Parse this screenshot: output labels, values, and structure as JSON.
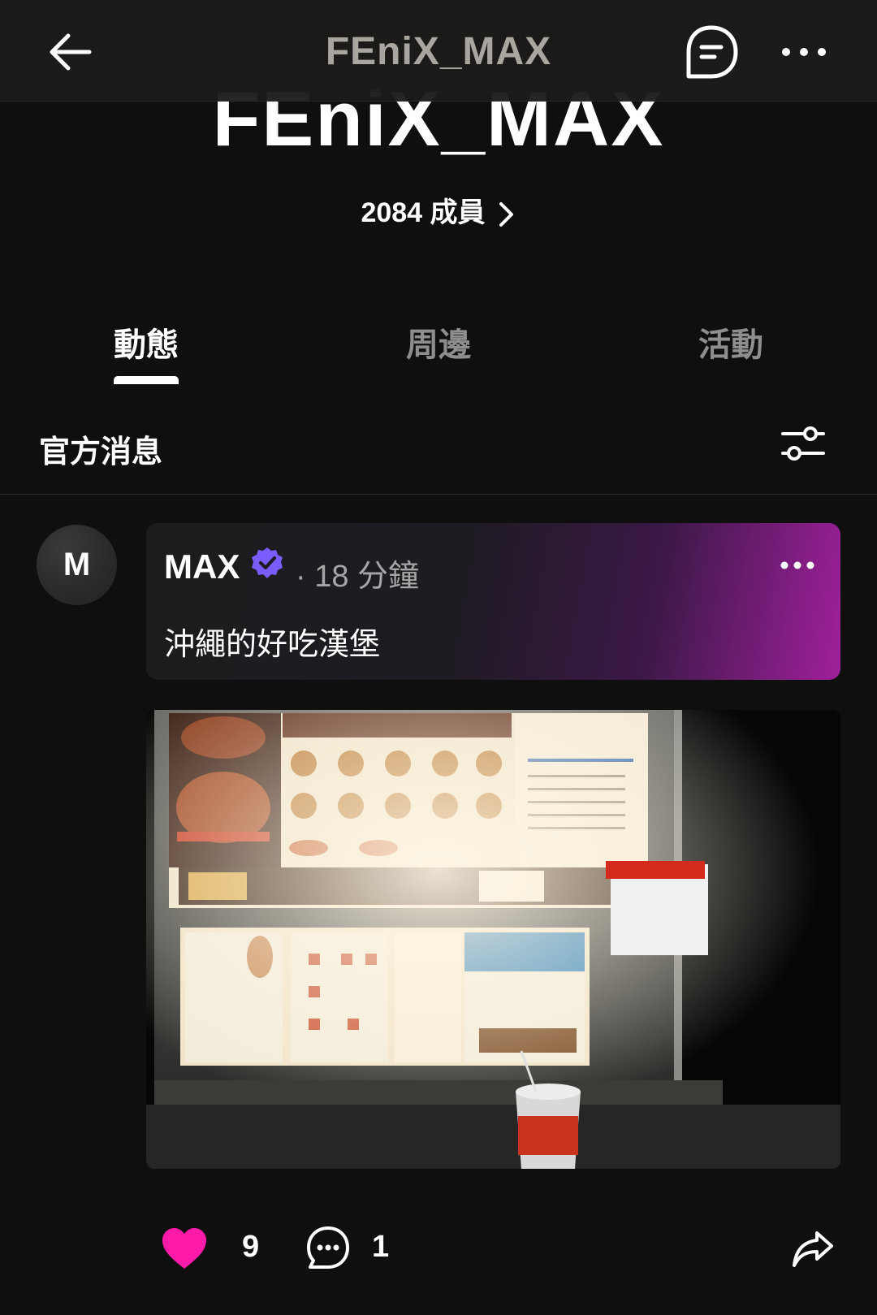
{
  "header": {
    "title": "FEniX_MAX",
    "hero_title": "FEniX_MAX"
  },
  "community": {
    "members_label": "2084 成員"
  },
  "tabs": [
    {
      "label": "動態",
      "active": true
    },
    {
      "label": "周邊",
      "active": false
    },
    {
      "label": "活動",
      "active": false
    }
  ],
  "feed": {
    "section_title": "官方消息"
  },
  "post": {
    "avatar_letter": "M",
    "author": "MAX",
    "time": "· 18 分鐘",
    "text": "沖繩的好吃漢堡",
    "likes": "9",
    "comments": "1"
  },
  "colors": {
    "like": "#ff1aa8",
    "verified": "#7b5cff",
    "card_gradient_end": "#a0209c"
  },
  "icons": [
    "back-arrow-icon",
    "chat-icon",
    "more-icon",
    "chevron-right-icon",
    "filter-icon",
    "verified-icon",
    "heart-icon",
    "comment-icon",
    "share-icon"
  ]
}
